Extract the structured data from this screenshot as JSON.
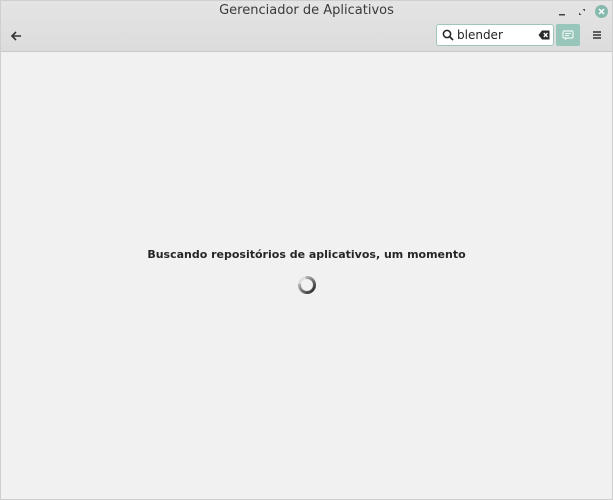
{
  "window": {
    "title": "Gerenciador de Aplicativos",
    "controls": {
      "minimize_icon": "minimize-icon",
      "maximize_icon": "maximize-icon",
      "close_icon": "close-icon",
      "close_color": "#86b9ad"
    }
  },
  "header": {
    "back_icon": "back-arrow-icon",
    "search": {
      "value": "blender",
      "icon": "search-icon",
      "clear_icon": "clear-text-icon"
    },
    "search_toggle_icon": "search-toggle-icon",
    "search_toggle_color": "#99c6bb",
    "menu_icon": "hamburger-menu-icon"
  },
  "main": {
    "loading_message": "Buscando repositórios de aplicativos, um momento",
    "spinner_icon": "loading-spinner-icon"
  }
}
